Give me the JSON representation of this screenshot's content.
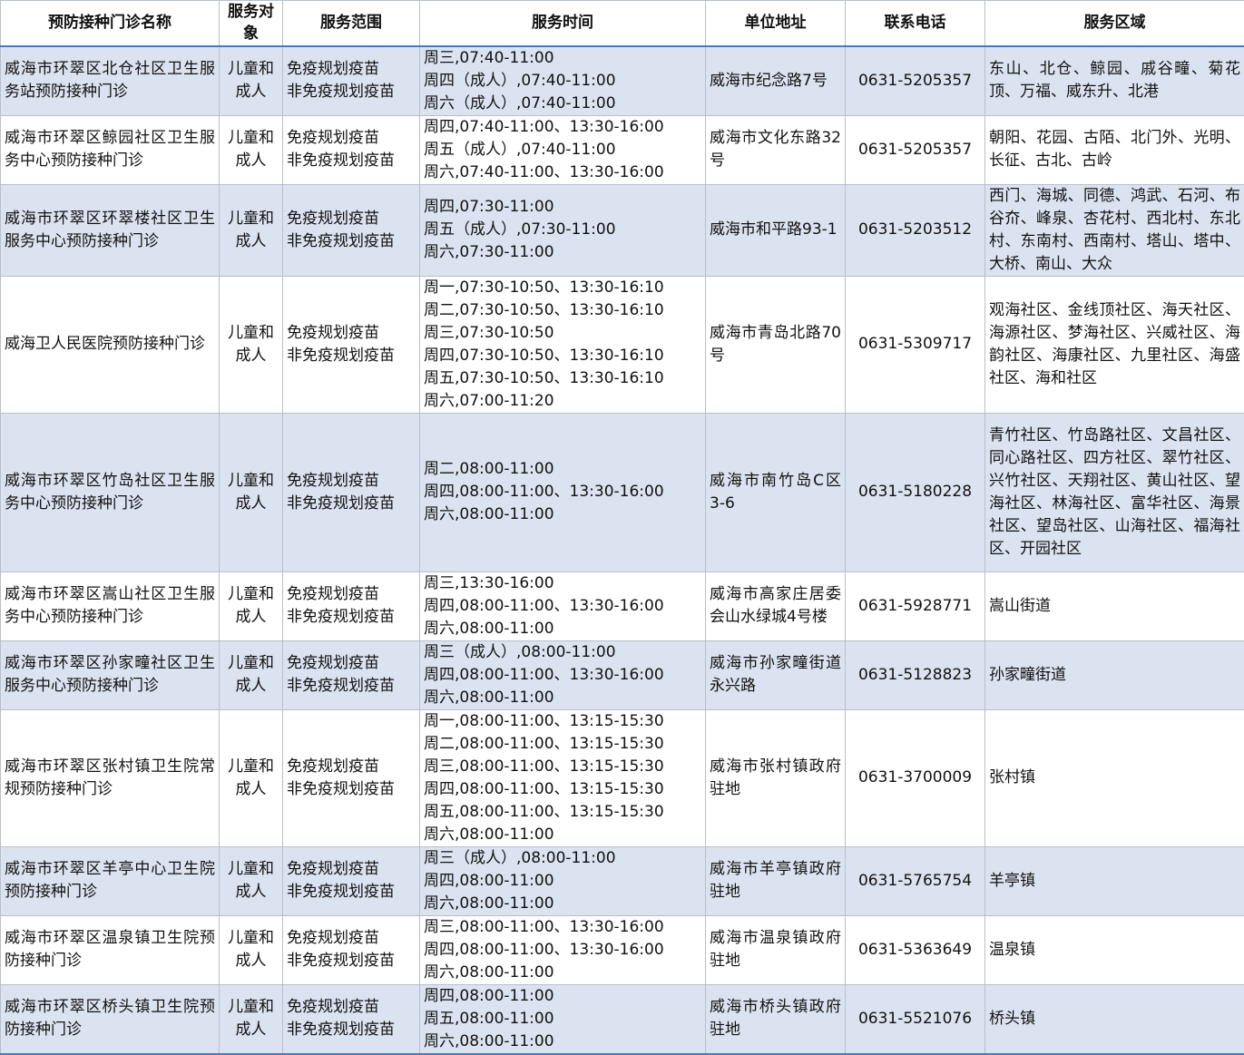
{
  "headers": {
    "name": "预防接种门诊名称",
    "target": "服务对象",
    "scope": "服务范围",
    "time": "服务时间",
    "address": "单位地址",
    "phone": "联系电话",
    "area": "服务区域"
  },
  "rows": [
    {
      "name": "威海市环翠区北仓社区卫生服务站预防接种门诊",
      "target": "儿童和成人",
      "scope": [
        "免疫规划疫苗",
        "非免疫规划疫苗"
      ],
      "time": [
        "周三,07:40-11:00",
        "周四（成人）,07:40-11:00",
        "周六（成人）,07:40-11:00"
      ],
      "address": "威海市纪念路7号",
      "phone": "0631-5205357",
      "area": "东山、北仓、鲸园、戚谷疃、菊花顶、万福、威东升、北港"
    },
    {
      "name": "威海市环翠区鲸园社区卫生服务中心预防接种门诊",
      "target": "儿童和成人",
      "scope": [
        "免疫规划疫苗",
        "非免疫规划疫苗"
      ],
      "time": [
        "周四,07:40-11:00、13:30-16:00",
        "周五（成人）,07:40-11:00",
        "周六,07:40-11:00、13:30-16:00"
      ],
      "address": "威海市文化东路32号",
      "phone": "0631-5205357",
      "area": "朝阳、花园、古陌、北门外、光明、长征、古北、古岭"
    },
    {
      "name": "威海市环翠区环翠楼社区卫生服务中心预防接种门诊",
      "target": "儿童和成人",
      "scope": [
        "免疫规划疫苗",
        "非免疫规划疫苗"
      ],
      "time": [
        "周四,07:30-11:00",
        "周五（成人）,07:30-11:00",
        "周六,07:30-11:00"
      ],
      "address": "威海市和平路93-1",
      "phone": "0631-5203512",
      "area": "西门、海城、同德、鸿武、石河、布谷夼、峰泉、杏花村、西北村、东北村、东南村、西南村、塔山、塔中、大桥、南山、大众"
    },
    {
      "name": "威海卫人民医院预防接种门诊",
      "target": "儿童和成人",
      "scope": [
        "免疫规划疫苗",
        "非免疫规划疫苗"
      ],
      "time": [
        "周一,07:30-10:50、13:30-16:10",
        "周二,07:30-10:50、13:30-16:10",
        "周三,07:30-10:50",
        "周四,07:30-10:50、13:30-16:10",
        "周五,07:30-10:50、13:30-16:10",
        "周六,07:00-11:20"
      ],
      "address": "威海市青岛北路70号",
      "phone": "0631-5309717",
      "area": "观海社区、金线顶社区、海天社区、海源社区、梦海社区、兴威社区、海韵社区、海康社区、九里社区、海盛社区、海和社区"
    },
    {
      "name": "威海市环翠区竹岛社区卫生服务中心预防接种门诊",
      "target": "儿童和成人",
      "scope": [
        "免疫规划疫苗",
        "非免疫规划疫苗"
      ],
      "time": [
        "周二,08:00-11:00",
        "周四,08:00-11:00、13:30-16:00",
        "周六,08:00-11:00"
      ],
      "address": "威海市南竹岛C区3-6",
      "phone": "0631-5180228",
      "area": "青竹社区、竹岛路社区、文昌社区、同心路社区、四方社区、翠竹社区、兴竹社区、天翔社区、黄山社区、望海社区、林海社区、富华社区、海景社区、望岛社区、山海社区、福海社区、开园社区"
    },
    {
      "name": "威海市环翠区嵩山社区卫生服务中心预防接种门诊",
      "target": "儿童和成人",
      "scope": [
        "免疫规划疫苗",
        "非免疫规划疫苗"
      ],
      "time": [
        "周三,13:30-16:00",
        "周四,08:00-11:00、13:30-16:00",
        "周六,08:00-11:00"
      ],
      "address": "威海市高家庄居委会山水绿城4号楼",
      "phone": "0631-5928771",
      "area": "嵩山街道"
    },
    {
      "name": "威海市环翠区孙家疃社区卫生服务中心预防接种门诊",
      "target": "儿童和成人",
      "scope": [
        "免疫规划疫苗",
        "非免疫规划疫苗"
      ],
      "time": [
        "周三（成人）,08:00-11:00",
        "周四,08:00-11:00、13:30-16:00",
        "周六,08:00-11:00"
      ],
      "address": "威海市孙家疃街道永兴路",
      "phone": "0631-5128823",
      "area": "孙家疃街道"
    },
    {
      "name": "威海市环翠区张村镇卫生院常规预防接种门诊",
      "target": "儿童和成人",
      "scope": [
        "免疫规划疫苗",
        "非免疫规划疫苗"
      ],
      "time": [
        "周一,08:00-11:00、13:15-15:30",
        "周二,08:00-11:00、13:15-15:30",
        "周三,08:00-11:00、13:15-15:30",
        "周四,08:00-11:00、13:15-15:30",
        "周五,08:00-11:00、13:15-15:30",
        "周六,08:00-11:00"
      ],
      "address": "威海市张村镇政府驻地",
      "phone": "0631-3700009",
      "area": "张村镇"
    },
    {
      "name": "威海市环翠区羊亭中心卫生院预防接种门诊",
      "target": "儿童和成人",
      "scope": [
        "免疫规划疫苗",
        "非免疫规划疫苗"
      ],
      "time": [
        "周三（成人）,08:00-11:00",
        "周四,08:00-11:00",
        "周六,08:00-11:00"
      ],
      "address": "威海市羊亭镇政府驻地",
      "phone": "0631-5765754",
      "area": "羊亭镇"
    },
    {
      "name": "威海市环翠区温泉镇卫生院预防接种门诊",
      "target": "儿童和成人",
      "scope": [
        "免疫规划疫苗",
        "非免疫规划疫苗"
      ],
      "time": [
        "周三,08:00-11:00、13:30-16:00",
        "周四,08:00-11:00、13:30-16:00",
        "周六,08:00-11:00"
      ],
      "address": "威海市温泉镇政府驻地",
      "phone": "0631-5363649",
      "area": "温泉镇"
    },
    {
      "name": "威海市环翠区桥头镇卫生院预防接种门诊",
      "target": "儿童和成人",
      "scope": [
        "免疫规划疫苗",
        "非免疫规划疫苗"
      ],
      "time": [
        "周四,08:00-11:00",
        "周五,08:00-11:00",
        "周六,08:00-11:00"
      ],
      "address": "威海市桥头镇政府驻地",
      "phone": "0631-5521076",
      "area": "桥头镇"
    }
  ]
}
